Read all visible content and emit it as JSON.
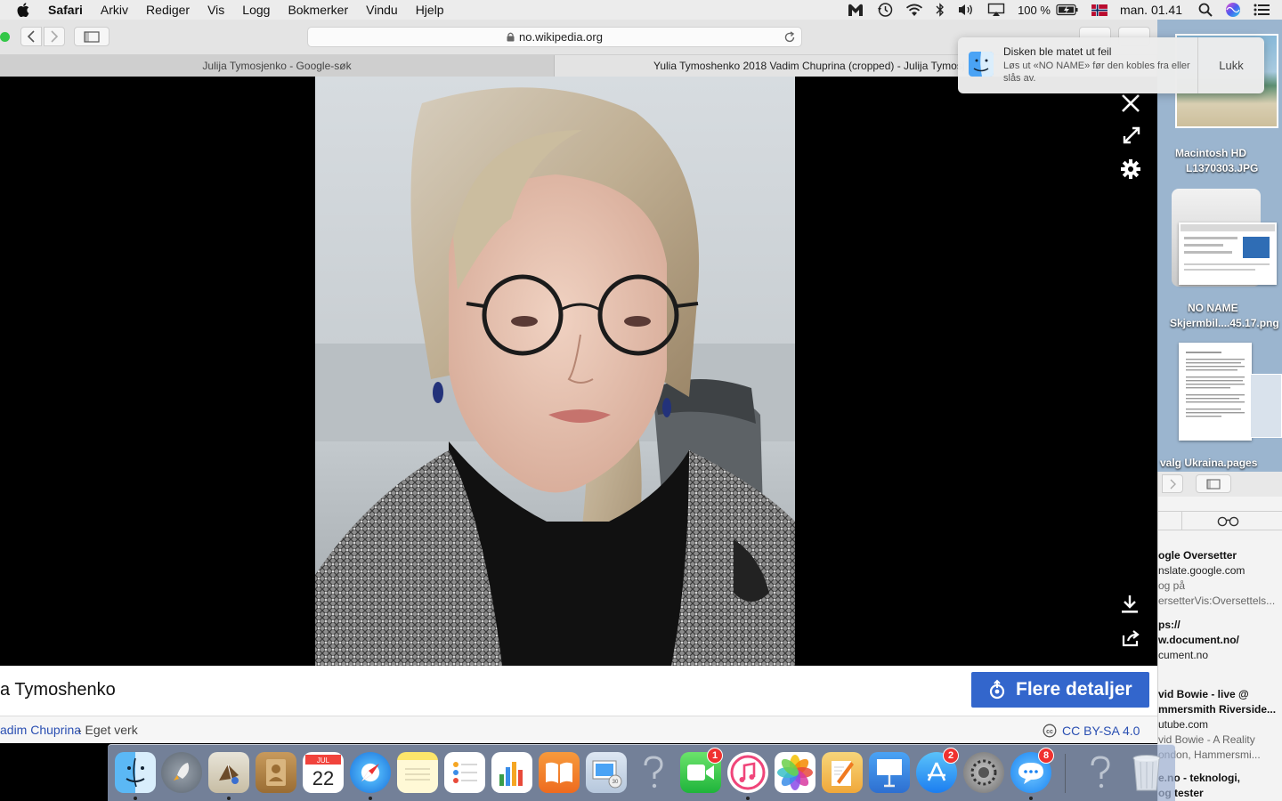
{
  "menubar": {
    "app": "Safari",
    "items": [
      "Arkiv",
      "Rediger",
      "Vis",
      "Logg",
      "Bokmerker",
      "Vindu",
      "Hjelp"
    ],
    "battery": "100 %",
    "clock": "man. 01.41"
  },
  "browser": {
    "url": "no.wikipedia.org",
    "tabs": [
      {
        "label": "Julija Tymosjenko - Google-søk"
      },
      {
        "label": "Yulia Tymoshenko 2018 Vadim Chuprina (cropped) - Julija Tymosj"
      }
    ]
  },
  "viewer": {
    "title": "a Tymoshenko",
    "more_button": "Flere detaljer",
    "author": "adim Chuprina",
    "source": " - Eget verk",
    "license": "CC BY-SA 4.0"
  },
  "notification": {
    "title": "Disken ble matet ut feil",
    "body": "Løs ut «NO NAME» før den kobles fra eller slås av.",
    "button": "Lukk"
  },
  "desktop": {
    "labels": {
      "hd": "Macintosh HD",
      "jpg": "L1370303.JPG",
      "noname": "NO NAME",
      "png": "Skjermbil....45.17.png",
      "pages": "valg Ukraina.pages"
    }
  },
  "reading_list": [
    {
      "title": "ogle Oversetter",
      "url": "nslate.google.com",
      "desc1": "og på",
      "desc2": "ersetterVis:Oversettels..."
    },
    {
      "title": "ps://",
      "url": "w.document.no/",
      "desc1": "cument.no",
      "desc2": ""
    },
    {
      "title": "vid Bowie - live @",
      "url": "mmersmith Riverside...",
      "desc1": "utube.com",
      "desc2": "vid Bowie - A Reality",
      "desc3": "ondon, Hammersmi..."
    },
    {
      "title": "e.no - teknologi,",
      "url": "og tester",
      "desc1": "",
      "desc2": ""
    }
  ],
  "dock": {
    "badges": {
      "facetime": "1",
      "appstore": "2",
      "messages": "8"
    }
  },
  "colors": {
    "accent": "#3366cc",
    "link": "#2a4fb2"
  }
}
